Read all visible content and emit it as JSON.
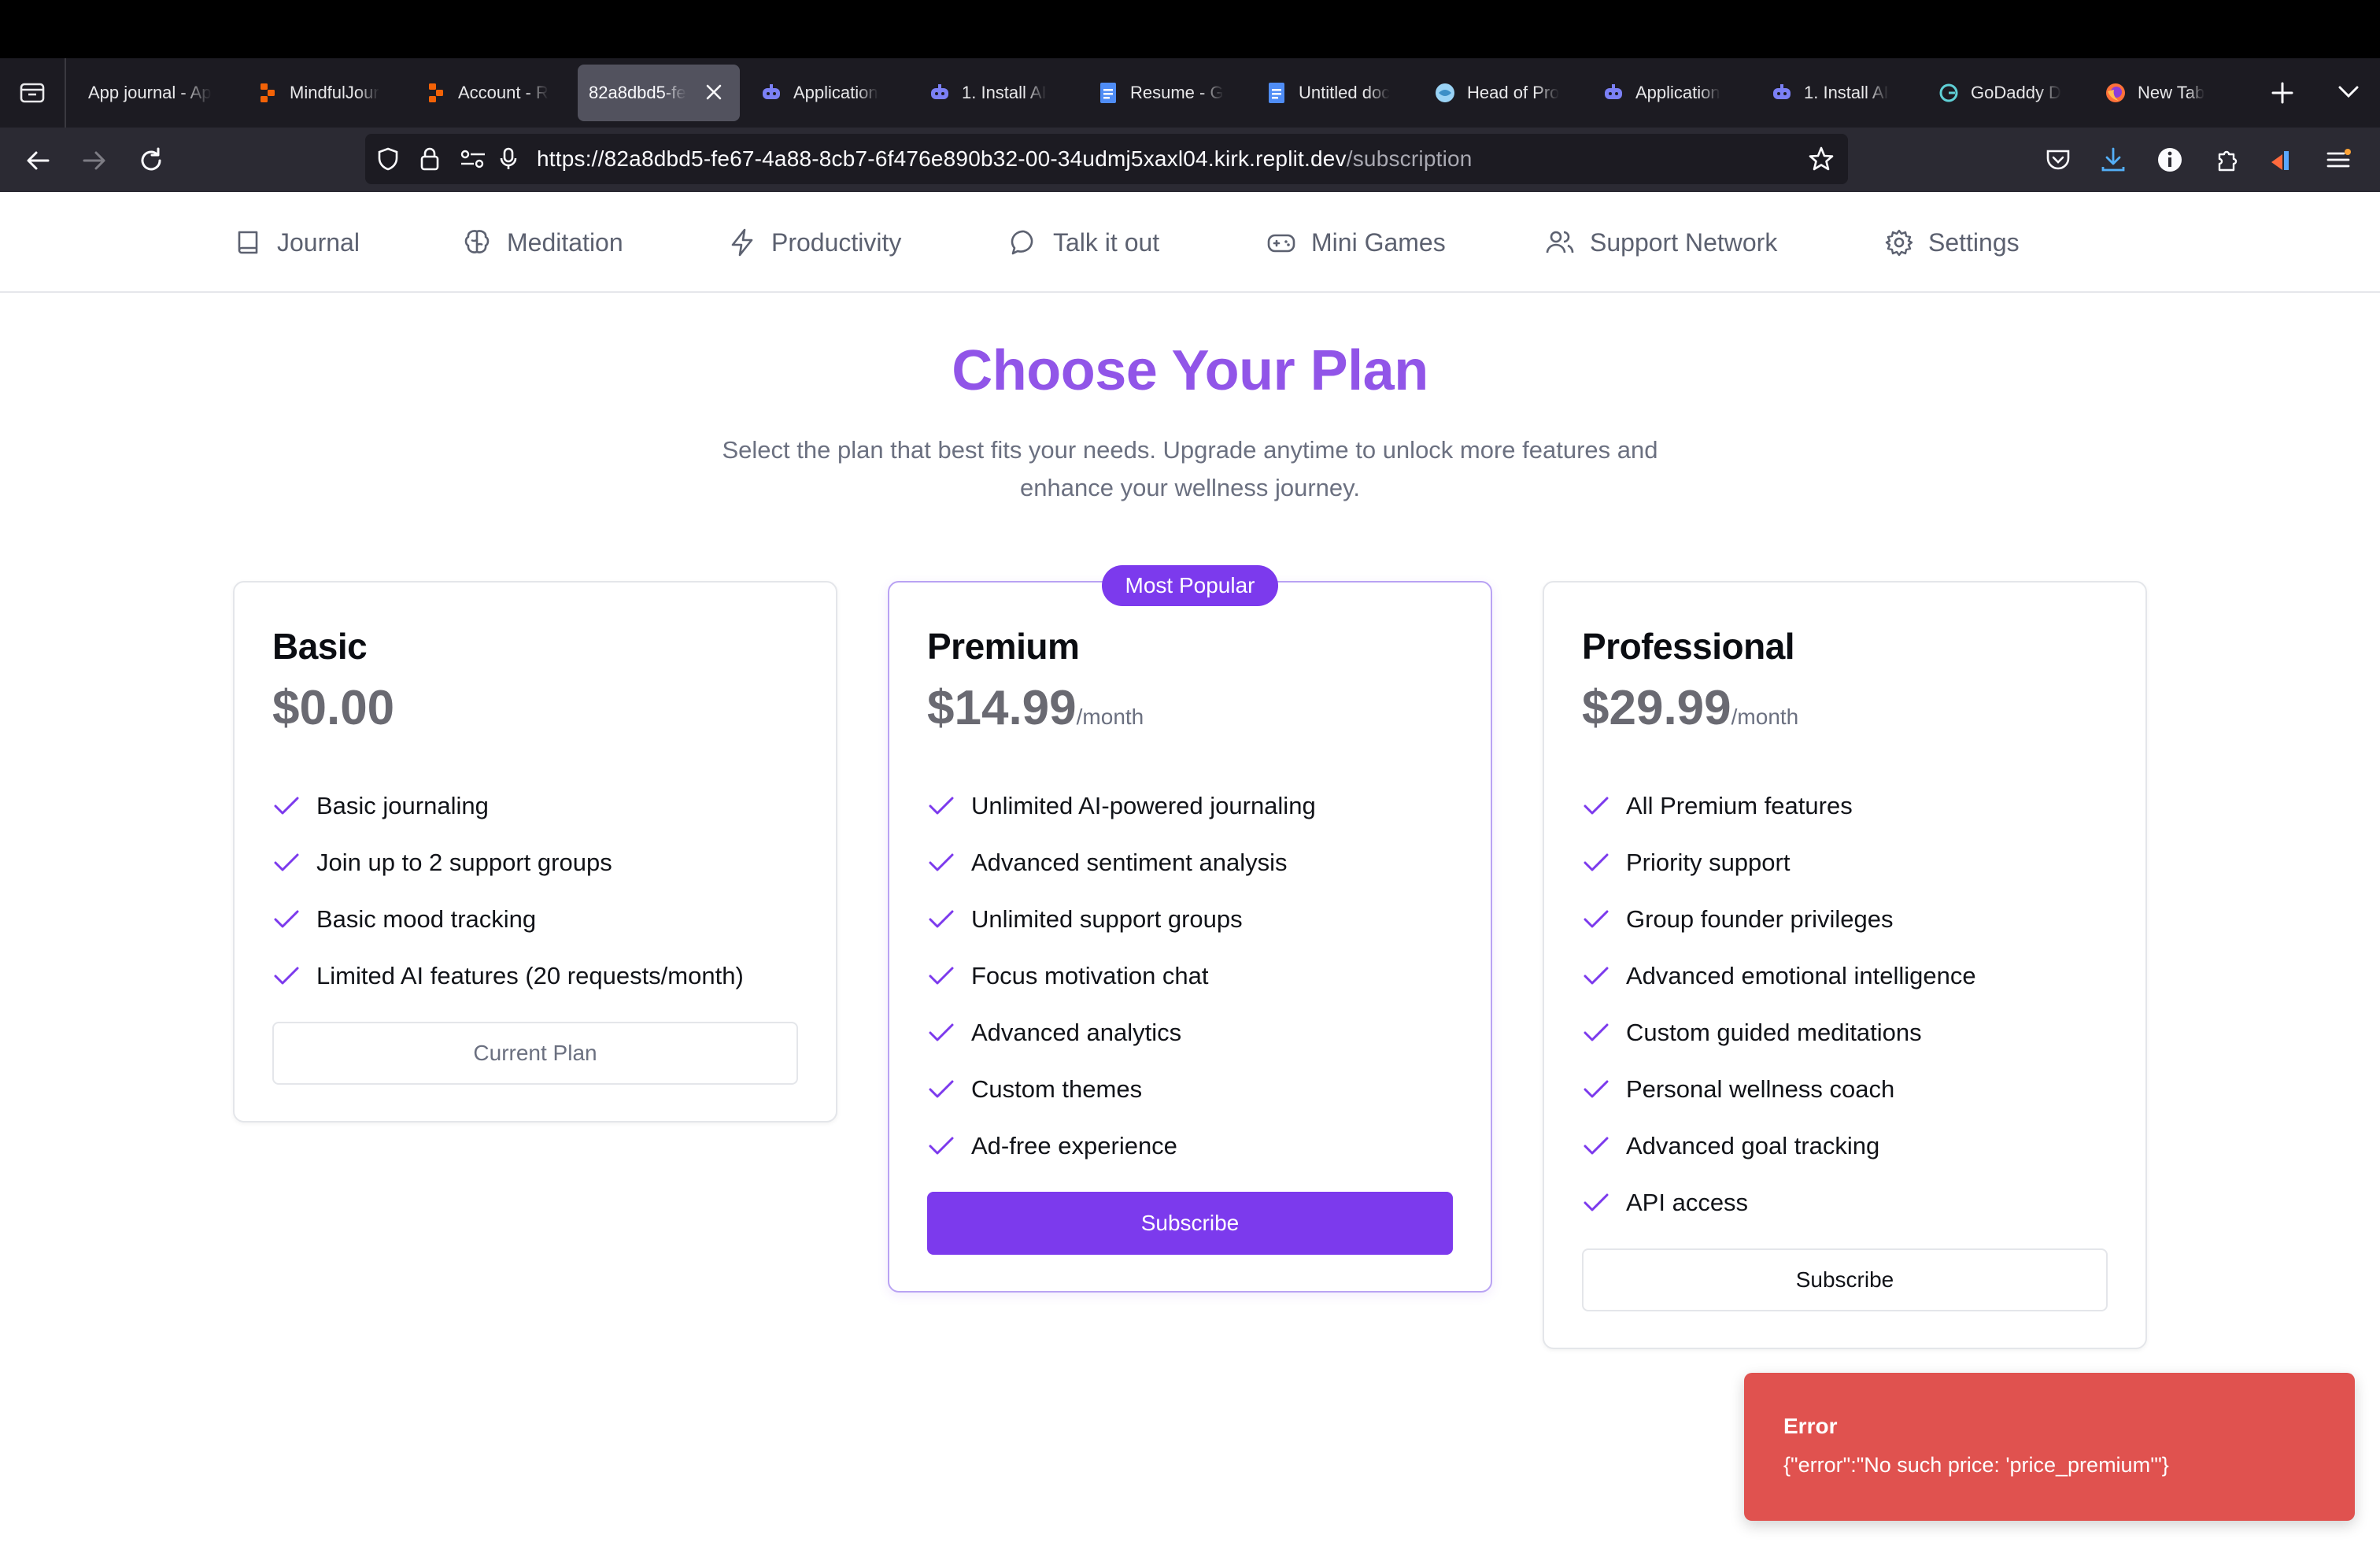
{
  "browser": {
    "tabs": [
      {
        "title": "App journal - Ap",
        "favicon": "google-doc-icon",
        "active": false
      },
      {
        "title": "MindfulJour",
        "favicon": "replit-icon",
        "active": false
      },
      {
        "title": "Account - R",
        "favicon": "replit-icon",
        "active": false
      },
      {
        "title": "82a8dbd5-fe",
        "favicon": "none",
        "active": true
      },
      {
        "title": "Application",
        "favicon": "claude-bot-icon",
        "active": false
      },
      {
        "title": "1. Install AI",
        "favicon": "claude-bot-icon",
        "active": false
      },
      {
        "title": "Resume - G",
        "favicon": "google-doc-icon",
        "active": false
      },
      {
        "title": "Untitled doc",
        "favicon": "google-doc-icon",
        "active": false
      },
      {
        "title": "Head of Pro",
        "favicon": "globe-icon",
        "active": false
      },
      {
        "title": "Application",
        "favicon": "claude-bot-icon",
        "active": false
      },
      {
        "title": "1. Install AI",
        "favicon": "claude-bot-icon",
        "active": false
      },
      {
        "title": "GoDaddy D",
        "favicon": "godaddy-icon",
        "active": false
      },
      {
        "title": "New Tab",
        "favicon": "firefox-icon",
        "active": false
      }
    ],
    "url_main": "https://82a8dbd5-fe67-4a88-8cb7-6f476e890b32-00-34udmj5xaxl04.kirk.replit.dev",
    "url_path": "/subscription",
    "colors": {
      "chrome_dark": "#1c1b22",
      "toolbar": "#2b2a33",
      "download_accent": "#54aff8"
    }
  },
  "appnav": {
    "items": [
      {
        "label": "Journal",
        "icon": "book-icon"
      },
      {
        "label": "Meditation",
        "icon": "brain-icon"
      },
      {
        "label": "Productivity",
        "icon": "lightning-icon"
      },
      {
        "label": "Talk it out",
        "icon": "chat-bubble-icon"
      },
      {
        "label": "Mini Games",
        "icon": "gamepad-icon"
      },
      {
        "label": "Support Network",
        "icon": "users-icon"
      },
      {
        "label": "Settings",
        "icon": "gear-icon"
      }
    ]
  },
  "page": {
    "title": "Choose Your Plan",
    "subtitle": "Select the plan that best fits your needs. Upgrade anytime to unlock more features and enhance your wellness journey.",
    "accent_color": "#7c3aed",
    "title_color": "#9155e8"
  },
  "plans": [
    {
      "name": "Basic",
      "price": "$0.00",
      "period": "",
      "features": [
        "Basic journaling",
        "Join up to 2 support groups",
        "Basic mood tracking",
        "Limited AI features (20 requests/month)"
      ],
      "button": "Current Plan"
    },
    {
      "name": "Premium",
      "badge": "Most Popular",
      "price": "$14.99",
      "period": "/month",
      "features": [
        "Unlimited AI-powered journaling",
        "Advanced sentiment analysis",
        "Unlimited support groups",
        "Focus motivation chat",
        "Advanced analytics",
        "Custom themes",
        "Ad-free experience"
      ],
      "button": "Subscribe"
    },
    {
      "name": "Professional",
      "price": "$29.99",
      "period": "/month",
      "features": [
        "All Premium features",
        "Priority support",
        "Group founder privileges",
        "Advanced emotional intelligence",
        "Custom guided meditations",
        "Personal wellness coach",
        "Advanced goal tracking",
        "API access"
      ],
      "button": "Subscribe"
    }
  ],
  "toast": {
    "title": "Error",
    "message": "{\"error\":\"No such price: 'price_premium'\"}",
    "color": "#e0524f"
  }
}
